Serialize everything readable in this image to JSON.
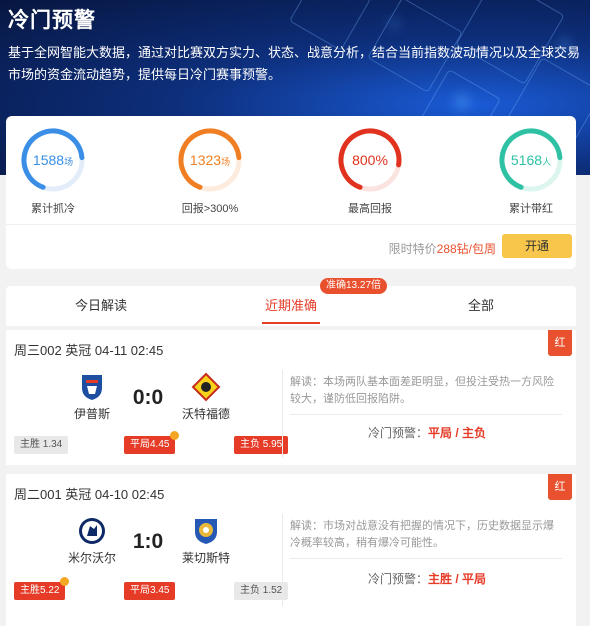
{
  "hero": {
    "title": "冷门预警",
    "description": "基于全网智能大数据，通过对比赛双方实力、状态、战意分析，结合当前指数波动情况以及全球交易市场的资金流动趋势，提供每日冷门赛事预警。"
  },
  "stats": [
    {
      "value": "1588",
      "unit": "场",
      "label": "累计抓冷",
      "color": "#3a8ee6",
      "fill": 0.68
    },
    {
      "value": "1323",
      "unit": "场",
      "label": "回报>300%",
      "color": "#f07f23",
      "fill": 0.68
    },
    {
      "value": "800%",
      "unit": "",
      "label": "最高回报",
      "color": "#e0321f",
      "fill": 0.72
    },
    {
      "value": "5168",
      "unit": "人",
      "label": "累计带红",
      "color": "#2ec1a4",
      "fill": 0.68
    }
  ],
  "promo": {
    "prefix": "限时特价",
    "price": "288钻/包周",
    "button": "开通"
  },
  "tabs": [
    {
      "label": "今日解读",
      "active": false
    },
    {
      "label": "近期准确",
      "active": true
    },
    {
      "label": "全部",
      "active": false
    }
  ],
  "tab_badge": "准确13.27倍",
  "matches": [
    {
      "title": "周三002 英冠 04-11 02:45",
      "tag": "红",
      "home": {
        "name": "伊普斯",
        "crest": "ipswich-crest-icon"
      },
      "away": {
        "name": "沃特福德",
        "crest": "watford-crest-icon"
      },
      "score": "0:0",
      "odds": [
        {
          "label": "主胜",
          "value": "1.34",
          "style": "grey",
          "tick": false
        },
        {
          "label": "平局",
          "value": "4.45",
          "style": "red",
          "tick": true
        },
        {
          "label": "主负",
          "value": "5.95",
          "style": "red",
          "tick": false
        }
      ],
      "analysis": "解读：本场两队基本面差距明显，但投注受热一方风险较大，谨防低回报陷阱。",
      "warning_label": "冷门预警：",
      "warning_value": "平局 / 主负"
    },
    {
      "title": "周二001 英冠 04-10 02:45",
      "tag": "红",
      "home": {
        "name": "米尔沃尔",
        "crest": "millwall-crest-icon"
      },
      "away": {
        "name": "莱切斯特",
        "crest": "leicester-crest-icon"
      },
      "score": "1:0",
      "odds": [
        {
          "label": "主胜",
          "value": "5.22",
          "style": "red",
          "tick": true
        },
        {
          "label": "平局",
          "value": "3.45",
          "style": "red",
          "tick": false
        },
        {
          "label": "主负",
          "value": "1.52",
          "style": "grey",
          "tick": false
        }
      ],
      "analysis": "解读：市场对战意没有把握的情况下，历史数据显示爆冷概率较高，稍有爆冷可能性。",
      "warning_label": "冷门预警：",
      "warning_value": "主胜 / 平局"
    }
  ]
}
